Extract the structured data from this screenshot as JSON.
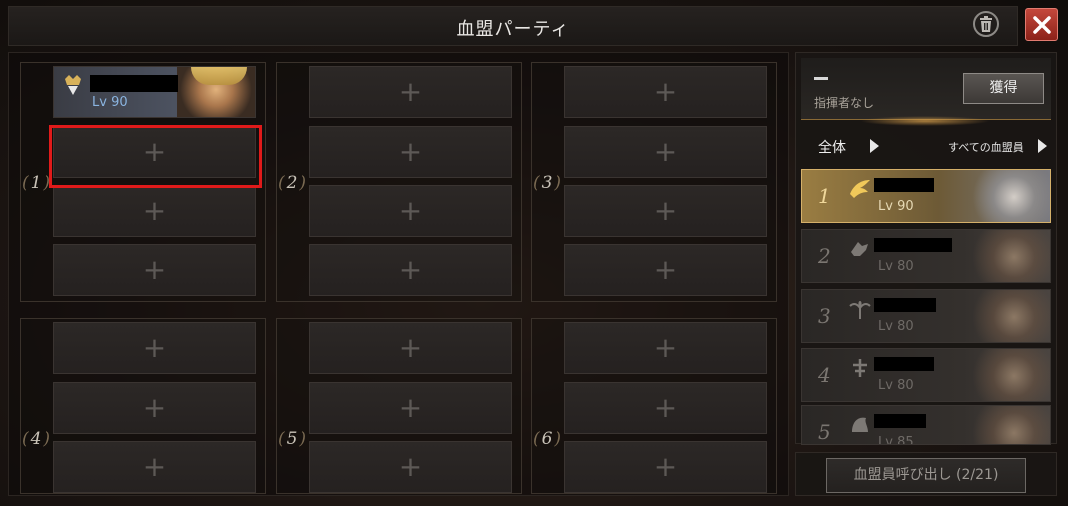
{
  "window": {
    "title": "血盟パーティ"
  },
  "groups": [
    {
      "number": "1",
      "slots": [
        {
          "filled": true,
          "level": "Lv 90"
        },
        {
          "filled": false,
          "label": "+"
        },
        {
          "filled": false,
          "label": "+"
        },
        {
          "filled": false,
          "label": "+"
        }
      ]
    },
    {
      "number": "2",
      "slots": [
        {
          "label": "+"
        },
        {
          "label": "+"
        },
        {
          "label": "+"
        },
        {
          "label": "+"
        }
      ]
    },
    {
      "number": "3",
      "slots": [
        {
          "label": "+"
        },
        {
          "label": "+"
        },
        {
          "label": "+"
        },
        {
          "label": "+"
        }
      ]
    },
    {
      "number": "4",
      "slots": [
        {
          "label": "+"
        },
        {
          "label": "+"
        },
        {
          "label": "+"
        }
      ]
    },
    {
      "number": "5",
      "slots": [
        {
          "label": "+"
        },
        {
          "label": "+"
        },
        {
          "label": "+"
        }
      ]
    },
    {
      "number": "6",
      "slots": [
        {
          "label": "+"
        },
        {
          "label": "+"
        },
        {
          "label": "+"
        }
      ]
    }
  ],
  "commander": {
    "value": "",
    "label": "指揮者なし",
    "get_label": "獲得"
  },
  "filters": {
    "all": "全体",
    "members": "すべての血盟員"
  },
  "members": [
    {
      "rank": "1",
      "level": "Lv 90",
      "selected": true
    },
    {
      "rank": "2",
      "level": "Lv 80",
      "selected": false
    },
    {
      "rank": "3",
      "level": "Lv 80",
      "selected": false
    },
    {
      "rank": "4",
      "level": "Lv 80",
      "selected": false
    },
    {
      "rank": "5",
      "level": "Lv 85",
      "selected": false
    }
  ],
  "call_button": "血盟員呼び出し (2/21)",
  "colors": {
    "highlight": "#e01a1a",
    "accent_gold": "#d5b06a",
    "close_red": "#b03a30"
  }
}
